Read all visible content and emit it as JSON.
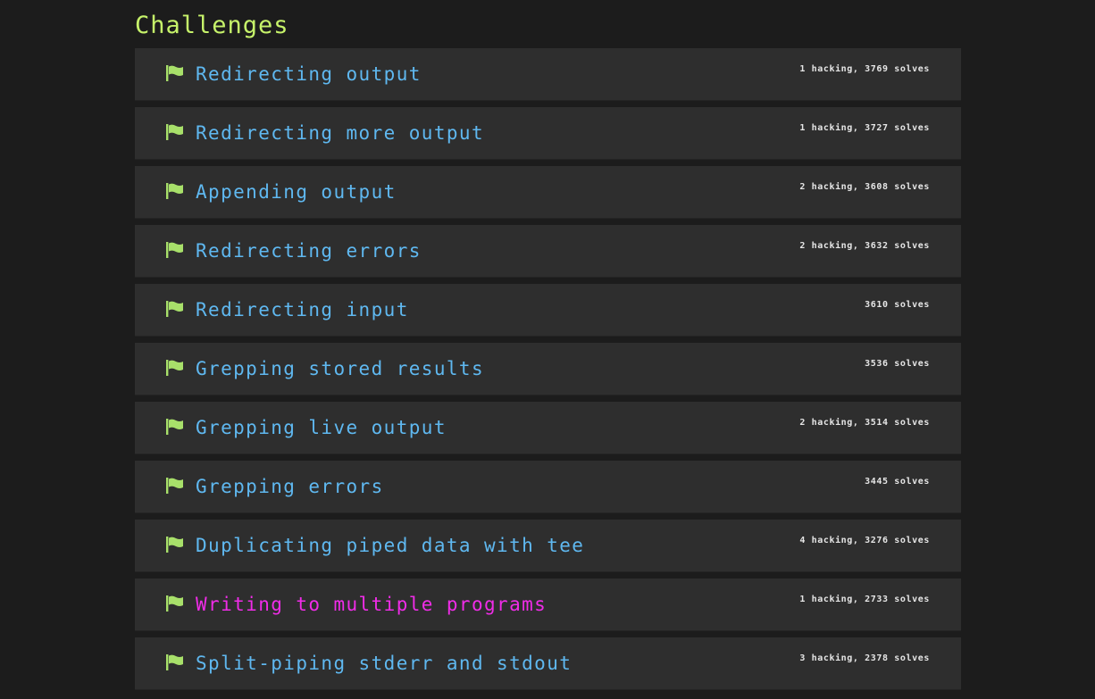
{
  "page": {
    "heading": "Challenges"
  },
  "colors": {
    "background": "#1c1c1c",
    "row_background": "#2e2e2e",
    "heading": "#c6f26a",
    "flag": "#a8e06a",
    "title": "#5fb8f0",
    "title_active": "#f02ce8",
    "stats": "#e6e6e6"
  },
  "challenges": [
    {
      "title": "Redirecting output",
      "stats": "1 hacking, 3769 solves",
      "icon": "flag-icon"
    },
    {
      "title": "Redirecting more output",
      "stats": "1 hacking, 3727 solves",
      "icon": "flag-icon"
    },
    {
      "title": "Appending output",
      "stats": "2 hacking, 3608 solves",
      "icon": "flag-icon"
    },
    {
      "title": "Redirecting errors",
      "stats": "2 hacking, 3632 solves",
      "icon": "flag-icon"
    },
    {
      "title": "Redirecting input",
      "stats": "3610 solves",
      "icon": "flag-icon"
    },
    {
      "title": "Grepping stored results",
      "stats": "3536 solves",
      "icon": "flag-icon"
    },
    {
      "title": "Grepping live output",
      "stats": "2 hacking, 3514 solves",
      "icon": "flag-icon"
    },
    {
      "title": "Grepping errors",
      "stats": "3445 solves",
      "icon": "flag-icon"
    },
    {
      "title": "Duplicating piped data with tee",
      "stats": "4 hacking, 3276 solves",
      "icon": "flag-icon"
    },
    {
      "title": "Writing to multiple programs",
      "stats": "1 hacking, 2733 solves",
      "icon": "flag-icon",
      "active": true
    },
    {
      "title": "Split-piping stderr and stdout",
      "stats": "3 hacking, 2378 solves",
      "icon": "flag-icon"
    }
  ]
}
